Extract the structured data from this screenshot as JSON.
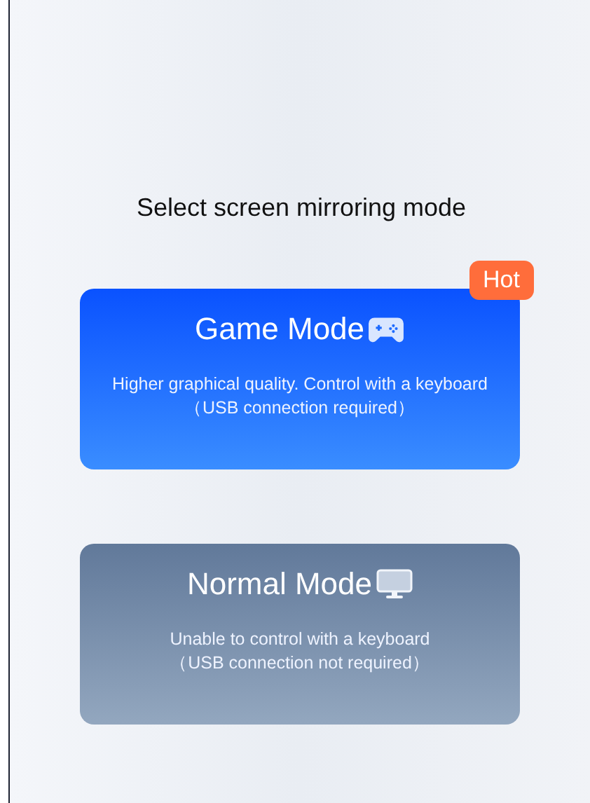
{
  "title": "Select screen mirroring mode",
  "modes": [
    {
      "kind": "game",
      "name": "Game Mode",
      "description": "Higher graphical quality. Control with a keyboard",
      "note": "（USB connection required）",
      "badge": "Hot"
    },
    {
      "kind": "normal",
      "name": "Normal Mode",
      "description": "Unable to control with a keyboard",
      "note": "（USB connection not required）"
    }
  ]
}
